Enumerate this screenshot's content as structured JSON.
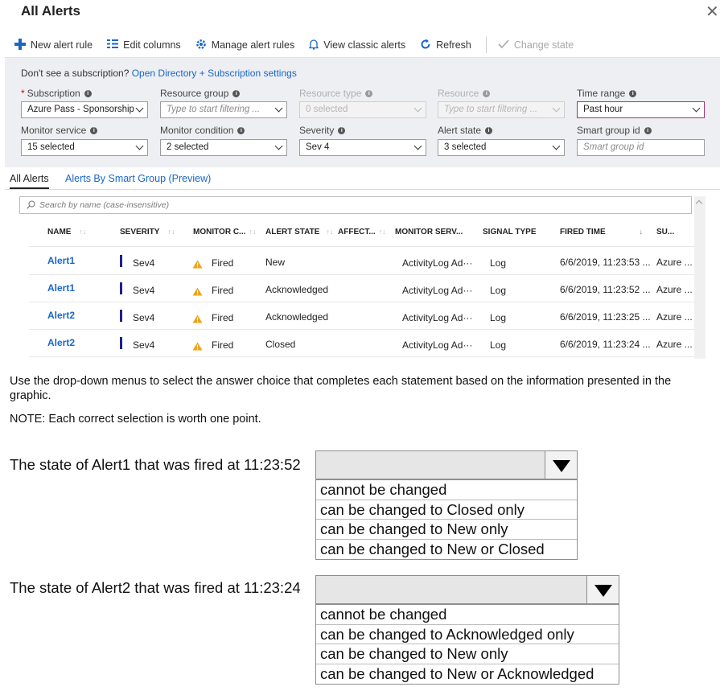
{
  "window": {
    "title": "All Alerts",
    "close_glyph": "✕"
  },
  "toolbar": {
    "items": [
      {
        "label": "New alert rule",
        "icon": "plus-icon"
      },
      {
        "label": "Edit columns",
        "icon": "columns-icon"
      },
      {
        "label": "Manage alert rules",
        "icon": "gear-icon"
      },
      {
        "label": "View classic alerts",
        "icon": "bell-icon"
      },
      {
        "label": "Refresh",
        "icon": "refresh-icon"
      }
    ],
    "change_state": {
      "label": "Change state",
      "icon": "checkmark-icon",
      "disabled": true
    }
  },
  "filters": {
    "subscription_note": "Don't see a subscription?",
    "subscription_link": "Open Directory + Subscription settings",
    "fields": {
      "subscription": {
        "label": "Subscription",
        "value": "Azure Pass - Sponsorship",
        "required": true
      },
      "resource_group": {
        "label": "Resource group",
        "placeholder": "Type to start filtering ..."
      },
      "resource_type": {
        "label": "Resource type",
        "value": "0 selected",
        "disabled": true
      },
      "resource": {
        "label": "Resource",
        "placeholder": "Type to start filtering ...",
        "disabled": true
      },
      "time_range": {
        "label": "Time range",
        "value": "Past hour"
      },
      "monitor_service": {
        "label": "Monitor service",
        "value": "15 selected"
      },
      "monitor_condition": {
        "label": "Monitor condition",
        "value": "2 selected"
      },
      "severity": {
        "label": "Severity",
        "value": "Sev 4"
      },
      "alert_state": {
        "label": "Alert state",
        "value": "3 selected"
      },
      "smart_group_id": {
        "label": "Smart group id",
        "placeholder": "Smart group id"
      }
    }
  },
  "tabs": [
    {
      "label": "All Alerts",
      "active": true
    },
    {
      "label": "Alerts By Smart Group (Preview)",
      "active": false
    }
  ],
  "grid": {
    "search_placeholder": "Search by name (case-insensitive)",
    "sort_glyph": "↑↓",
    "sort_glyph_active": "↓",
    "columns": [
      "NAME",
      "SEVERITY",
      "MONITOR C...",
      "ALERT STATE",
      "AFFECT...",
      "MONITOR SERV...",
      "SIGNAL TYPE",
      "FIRED TIME",
      "SU..."
    ],
    "rows": [
      {
        "name": "Alert1",
        "severity": "Sev4",
        "monitor_condition": "Fired",
        "alert_state": "New",
        "monitor_service": "ActivityLog Ad···",
        "signal_type": "Log",
        "fired_time": "6/6/2019, 11:23:53 ...",
        "subscription": "Azure ..."
      },
      {
        "name": "Alert1",
        "severity": "Sev4",
        "monitor_condition": "Fired",
        "alert_state": "Acknowledged",
        "monitor_service": "ActivityLog Ad···",
        "signal_type": "Log",
        "fired_time": "6/6/2019, 11:23:52 ...",
        "subscription": "Azure ..."
      },
      {
        "name": "Alert2",
        "severity": "Sev4",
        "monitor_condition": "Fired",
        "alert_state": "Acknowledged",
        "monitor_service": "ActivityLog Ad···",
        "signal_type": "Log",
        "fired_time": "6/6/2019, 11:23:25 ...",
        "subscription": "Azure ..."
      },
      {
        "name": "Alert2",
        "severity": "Sev4",
        "monitor_condition": "Fired",
        "alert_state": "Closed",
        "monitor_service": "ActivityLog Ad···",
        "signal_type": "Log",
        "fired_time": "6/6/2019, 11:23:24 ...",
        "subscription": "Azure ..."
      }
    ]
  },
  "question": {
    "instructions": "Use the drop-down menus to select the answer choice that completes each statement based on the information presented in the graphic.",
    "note": "NOTE: Each correct selection is worth one point.",
    "statements": [
      {
        "text": "The state of Alert1 that was fired at 11:23:52",
        "options": [
          "cannot be changed",
          "can be changed to Closed only",
          "can be changed to New only",
          "can be changed to New or Closed"
        ]
      },
      {
        "text": "The state of Alert2 that was fired at 11:23:24",
        "options": [
          "cannot be changed",
          "can be changed to Acknowledged only",
          "can be changed to New only",
          "can be changed to New or Acknowledged"
        ]
      }
    ]
  },
  "colors": {
    "accent": "#1a66c8",
    "severity_bar": "#1f1f8f",
    "warning": "#f0a21b",
    "required": "#d40000"
  }
}
